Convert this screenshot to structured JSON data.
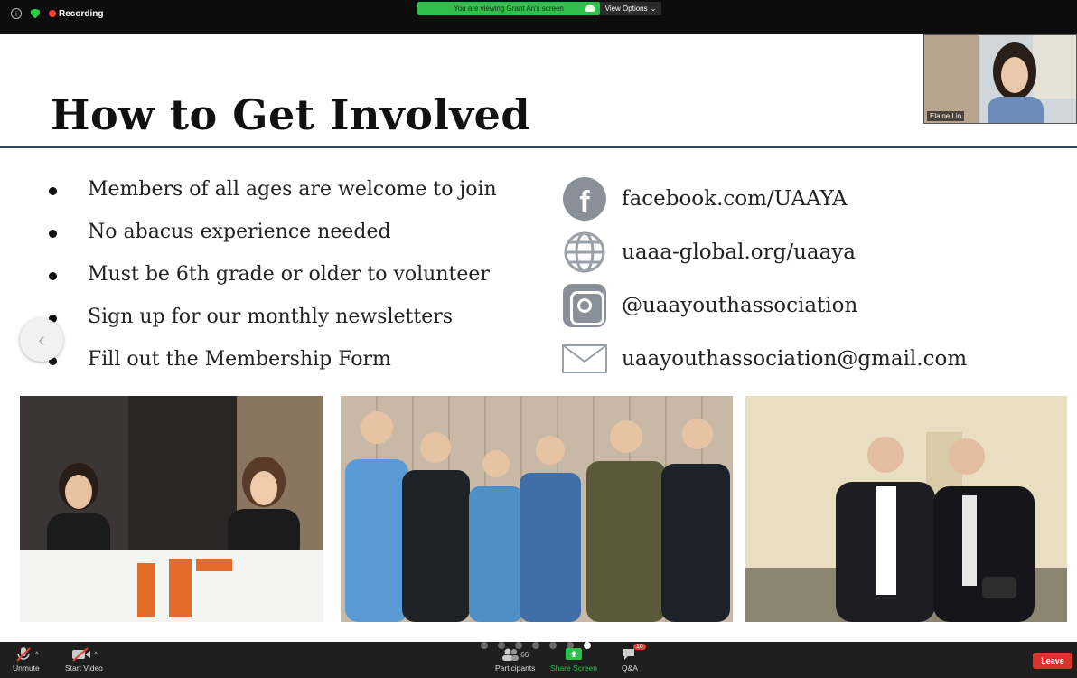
{
  "top_bar": {
    "recording_label": "Recording",
    "viewing_banner": "You are viewing Grant An's screen",
    "view_options": "View Options"
  },
  "slide": {
    "title": "How to Get Involved",
    "bullets": [
      "Members of all ages are welcome to join",
      "No abacus experience needed",
      "Must be 6th grade or older to volunteer",
      "Sign up for our monthly newsletters",
      "Fill out the Membership Form"
    ],
    "contacts": [
      {
        "icon": "facebook-icon",
        "text": "facebook.com/UAAYA"
      },
      {
        "icon": "globe-icon",
        "text": "uaaa-global.org/uaaya"
      },
      {
        "icon": "instagram-icon",
        "text": "@uaayouthassociation"
      },
      {
        "icon": "mail-icon",
        "text": "uaayouthassociation@gmail.com"
      }
    ]
  },
  "webcam": {
    "name": "Elaine Lin"
  },
  "bottom_bar": {
    "unmute": "Unmute",
    "start_video": "Start Video",
    "participants": "Participants",
    "participants_count": "66",
    "share_screen": "Share Screen",
    "qa": "Q&A",
    "qa_badge": "10",
    "leave": "Leave"
  },
  "carousel": {
    "total": 7,
    "active_index": 6
  },
  "colors": {
    "share_green": "#2fbf4a",
    "leave_red": "#d9342b",
    "title_rule": "#2c4670"
  }
}
